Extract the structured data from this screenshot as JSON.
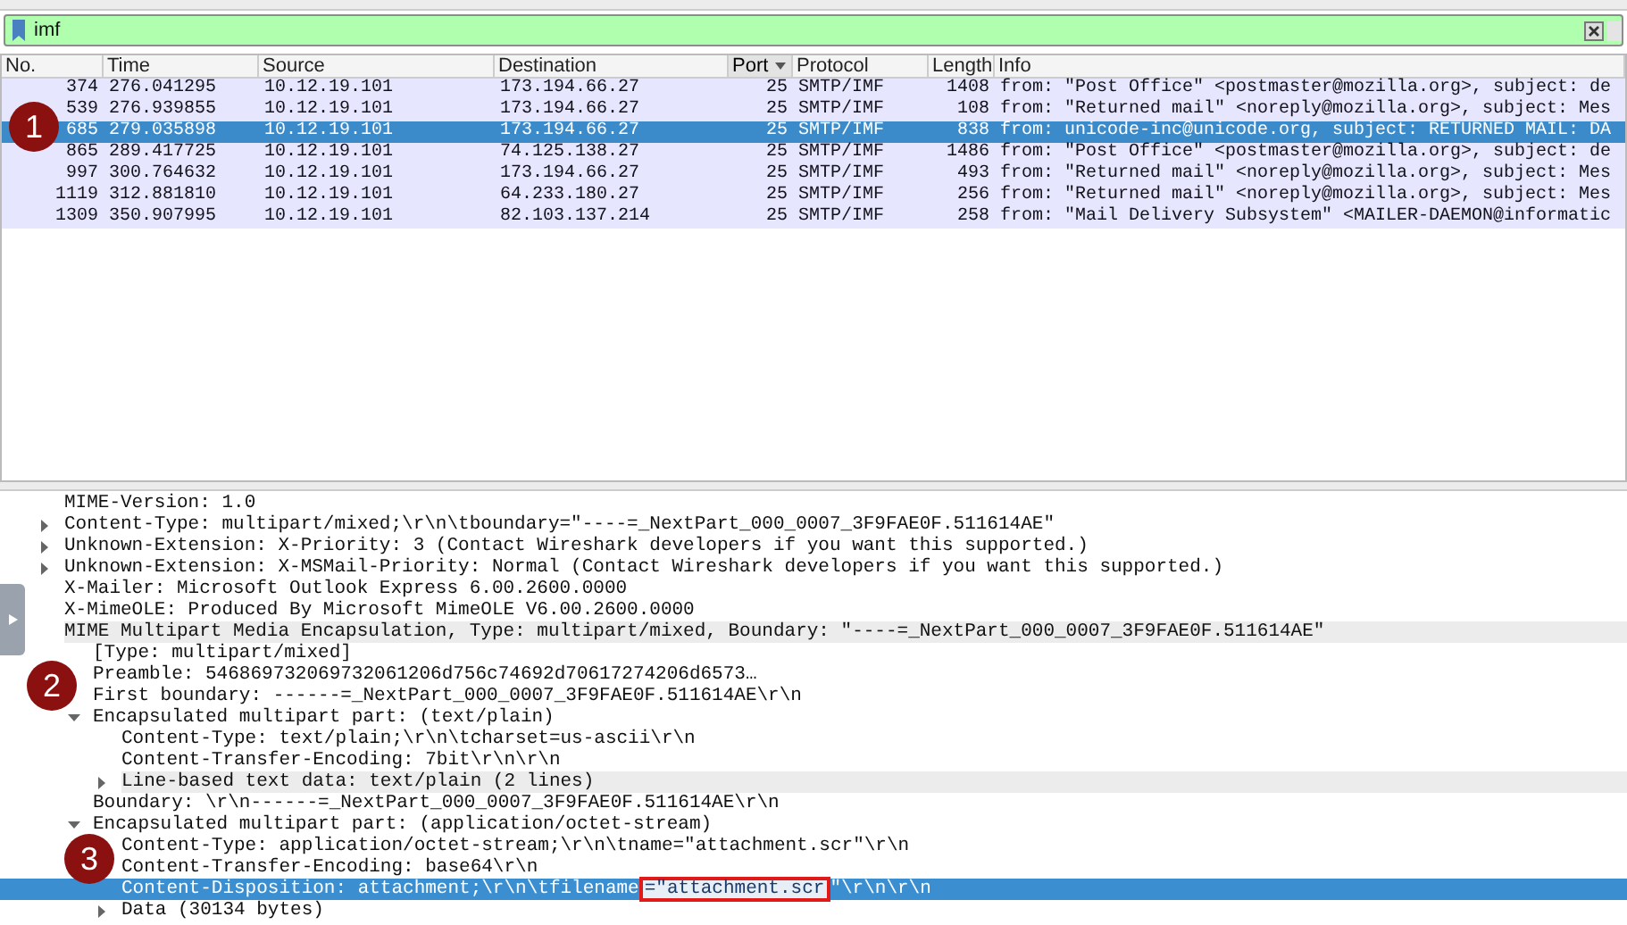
{
  "filter": {
    "value": "imf"
  },
  "packet_list": {
    "columns": [
      {
        "label": "No.",
        "sorted": false
      },
      {
        "label": "Time",
        "sorted": false
      },
      {
        "label": "Source",
        "sorted": false
      },
      {
        "label": "Destination",
        "sorted": false
      },
      {
        "label": "Port",
        "sorted": true
      },
      {
        "label": "Protocol",
        "sorted": false
      },
      {
        "label": "Length",
        "sorted": false
      },
      {
        "label": "Info",
        "sorted": false
      }
    ],
    "rows": [
      {
        "cells": [
          "374",
          "276.041295",
          "10.12.19.101",
          "173.194.66.27",
          "25",
          "SMTP/IMF",
          "1408",
          "from: \"Post Office\" <postmaster@mozilla.org>, subject: de"
        ],
        "selected": false
      },
      {
        "cells": [
          "539",
          "276.939855",
          "10.12.19.101",
          "173.194.66.27",
          "25",
          "SMTP/IMF",
          "108",
          "from: \"Returned mail\" <noreply@mozilla.org>, subject: Mes"
        ],
        "selected": false
      },
      {
        "cells": [
          "685",
          "279.035898",
          "10.12.19.101",
          "173.194.66.27",
          "25",
          "SMTP/IMF",
          "838",
          "from: unicode-inc@unicode.org, subject: RETURNED MAIL: DA"
        ],
        "selected": true
      },
      {
        "cells": [
          "865",
          "289.417725",
          "10.12.19.101",
          "74.125.138.27",
          "25",
          "SMTP/IMF",
          "1486",
          "from: \"Post Office\" <postmaster@mozilla.org>, subject: de"
        ],
        "selected": false
      },
      {
        "cells": [
          "997",
          "300.764632",
          "10.12.19.101",
          "173.194.66.27",
          "25",
          "SMTP/IMF",
          "493",
          "from: \"Returned mail\" <noreply@mozilla.org>, subject: Mes"
        ],
        "selected": false
      },
      {
        "cells": [
          "1119",
          "312.881810",
          "10.12.19.101",
          "64.233.180.27",
          "25",
          "SMTP/IMF",
          "256",
          "from: \"Returned mail\" <noreply@mozilla.org>, subject: Mes"
        ],
        "selected": false
      },
      {
        "cells": [
          "1309",
          "350.907995",
          "10.12.19.101",
          "82.103.137.214",
          "25",
          "SMTP/IMF",
          "258",
          "from: \"Mail Delivery Subsystem\" <MAILER-DAEMON@informatic"
        ],
        "selected": false
      }
    ]
  },
  "details": [
    {
      "kind": "leaf",
      "segments": [
        {
          "text": "MIME-Version: 1.0",
          "boxed": false
        }
      ],
      "selected": false,
      "shaded": false
    },
    {
      "kind": "branch",
      "expanded": false,
      "segments": [
        {
          "text": "Content-Type: multipart/mixed;\\r\\n\\tboundary=\"----=_NextPart_000_0007_3F9FAE0F.511614AE\"",
          "boxed": false
        }
      ],
      "selected": false,
      "shaded": false
    },
    {
      "kind": "branch",
      "expanded": false,
      "segments": [
        {
          "text": "Unknown-Extension: X-Priority: 3 (Contact Wireshark developers if you want this supported.)",
          "boxed": false
        }
      ],
      "selected": false,
      "shaded": false
    },
    {
      "kind": "branch",
      "expanded": false,
      "segments": [
        {
          "text": "Unknown-Extension: X-MSMail-Priority: Normal (Contact Wireshark developers if you want this supported.)",
          "boxed": false
        }
      ],
      "selected": false,
      "shaded": false
    },
    {
      "kind": "leaf",
      "segments": [
        {
          "text": "X-Mailer: Microsoft Outlook Express 6.00.2600.0000",
          "boxed": false
        }
      ],
      "selected": false,
      "shaded": false
    },
    {
      "kind": "leaf",
      "segments": [
        {
          "text": "X-MimeOLE: Produced By Microsoft MimeOLE V6.00.2600.0000",
          "boxed": false
        }
      ],
      "selected": false,
      "shaded": false
    },
    {
      "kind": "leaf",
      "segments": [
        {
          "text": "MIME Multipart Media Encapsulation, Type: multipart/mixed, Boundary: \"----=_NextPart_000_0007_3F9FAE0F.511614AE\"",
          "boxed": false
        }
      ],
      "selected": false,
      "shaded": true,
      "children": [
        {
          "kind": "leaf",
          "segments": [
            {
              "text": "[Type: multipart/mixed]",
              "boxed": false
            }
          ],
          "selected": false,
          "shaded": false
        },
        {
          "kind": "leaf",
          "segments": [
            {
              "text": "Preamble: 546869732069732061206d756c74692d70617274206d6573…",
              "boxed": false
            }
          ],
          "selected": false,
          "shaded": false
        },
        {
          "kind": "leaf",
          "segments": [
            {
              "text": "First boundary: ------=_NextPart_000_0007_3F9FAE0F.511614AE\\r\\n",
              "boxed": false
            }
          ],
          "selected": false,
          "shaded": false
        },
        {
          "kind": "branch",
          "expanded": true,
          "segments": [
            {
              "text": "Encapsulated multipart part:  (text/plain)",
              "boxed": false
            }
          ],
          "selected": false,
          "shaded": false,
          "children": [
            {
              "kind": "leaf",
              "segments": [
                {
                  "text": "Content-Type: text/plain;\\r\\n\\tcharset=us-ascii\\r\\n",
                  "boxed": false
                }
              ],
              "selected": false,
              "shaded": false
            },
            {
              "kind": "leaf",
              "segments": [
                {
                  "text": "Content-Transfer-Encoding: 7bit\\r\\n\\r\\n",
                  "boxed": false
                }
              ],
              "selected": false,
              "shaded": false
            },
            {
              "kind": "branch",
              "expanded": false,
              "segments": [
                {
                  "text": "Line-based text data: text/plain (2 lines)",
                  "boxed": false
                }
              ],
              "selected": false,
              "shaded": true
            }
          ]
        },
        {
          "kind": "leaf",
          "segments": [
            {
              "text": "Boundary: \\r\\n------=_NextPart_000_0007_3F9FAE0F.511614AE\\r\\n",
              "boxed": false
            }
          ],
          "selected": false,
          "shaded": false
        },
        {
          "kind": "branch",
          "expanded": true,
          "segments": [
            {
              "text": "Encapsulated multipart part:  (application/octet-stream)",
              "boxed": false
            }
          ],
          "selected": false,
          "shaded": false,
          "children": [
            {
              "kind": "leaf",
              "segments": [
                {
                  "text": "Content-Type: application/octet-stream;\\r\\n\\tname=\"attachment.scr\"\\r\\n",
                  "boxed": false
                }
              ],
              "selected": false,
              "shaded": false
            },
            {
              "kind": "leaf",
              "segments": [
                {
                  "text": "Content-Transfer-Encoding: base64\\r\\n",
                  "boxed": false
                }
              ],
              "selected": false,
              "shaded": false
            },
            {
              "kind": "leaf",
              "segments": [
                {
                  "text": "Content-Disposition: attachment;\\r\\n\\tfilename",
                  "boxed": false
                },
                {
                  "text": "=\"attachment.scr",
                  "boxed": true
                },
                {
                  "text": "\"\\r\\n\\r\\n",
                  "boxed": false
                }
              ],
              "selected": true,
              "shaded": false
            },
            {
              "kind": "branch",
              "expanded": false,
              "segments": [
                {
                  "text": "Data (30134 bytes)",
                  "boxed": false
                }
              ],
              "selected": false,
              "shaded": false
            }
          ]
        }
      ]
    }
  ],
  "callouts": [
    {
      "label": "1"
    },
    {
      "label": "2"
    },
    {
      "label": "3"
    }
  ]
}
